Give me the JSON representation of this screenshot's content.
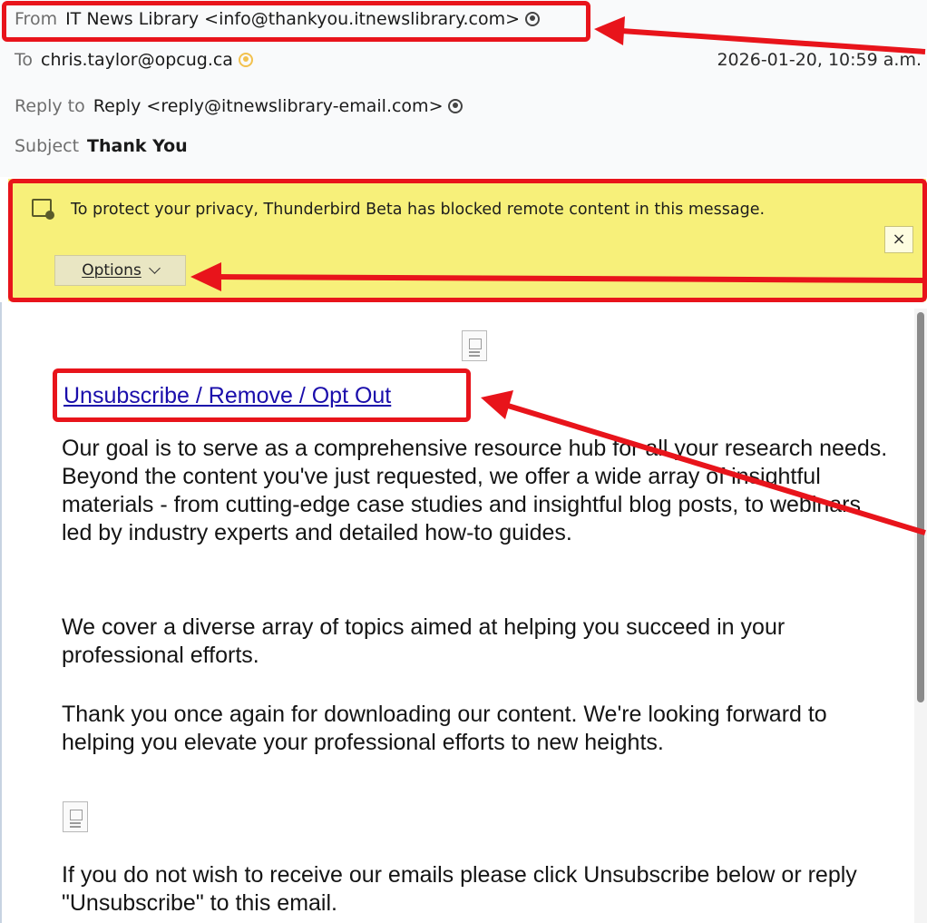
{
  "header": {
    "from_label": "From",
    "from_value": "IT News Library <info@thankyou.itnewslibrary.com>",
    "to_label": "To",
    "to_value": "chris.taylor@opcug.ca",
    "date": "2026-01-20, 10:59 a.m.",
    "reply_label": "Reply to",
    "reply_value": "Reply <reply@itnewslibrary-email.com>",
    "subject_label": "Subject",
    "subject_value": "Thank You"
  },
  "banner": {
    "message": "To protect your privacy, Thunderbird Beta has blocked remote content in this message.",
    "options_label": "Options",
    "close_glyph": "×"
  },
  "message": {
    "unsubscribe_link": "Unsubscribe / Remove / Opt Out",
    "paragraphs": [
      "Our goal is to serve as a comprehensive resource hub for all your research needs. Beyond the content you've just requested, we offer a wide array of insightful materials - from cutting-edge case studies and insightful blog posts, to webinars led by industry experts and detailed how-to guides.",
      "We cover a diverse array of topics aimed at helping you succeed in your professional efforts.",
      "Thank you once again for downloading our content. We're looking forward to helping you elevate your professional efforts to new heights.",
      "If you do not wish to receive our emails please click Unsubscribe below or reply \"Unsubscribe\" to this email."
    ]
  },
  "icons": {
    "contact": "contact-icon",
    "remote_content": "remote-content-icon",
    "image_placeholder": "image-placeholder-icon"
  },
  "colors": {
    "annotation": "#e8141b",
    "banner": "#f7f07a",
    "link": "#1a0dab"
  }
}
